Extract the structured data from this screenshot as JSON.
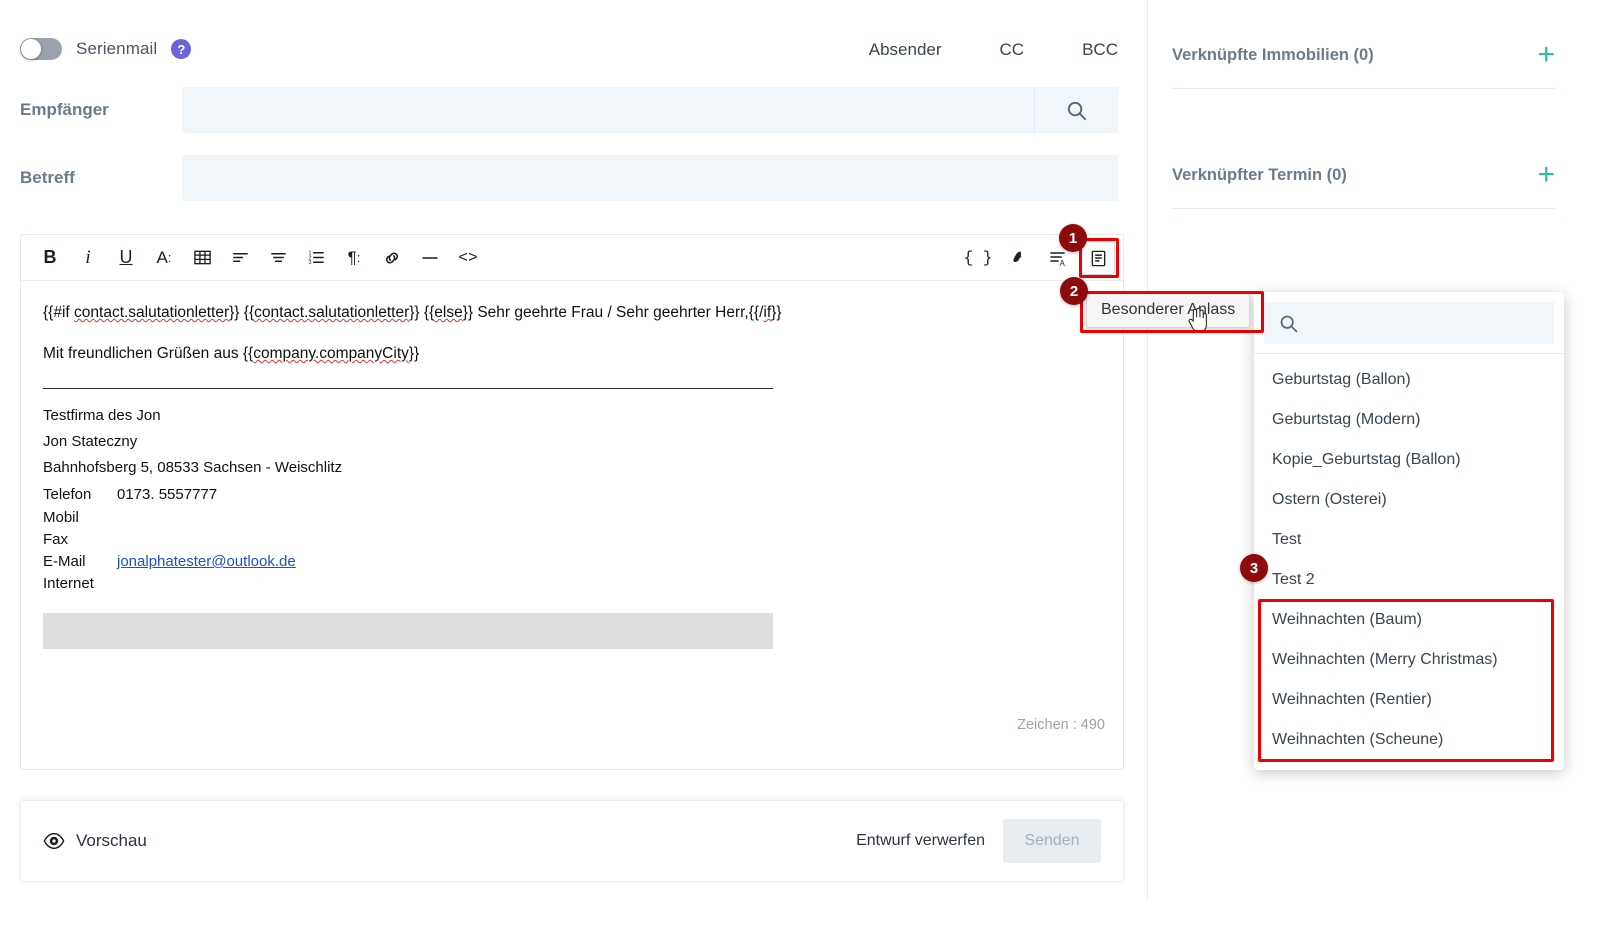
{
  "header": {
    "serienmail_label": "Serienmail",
    "serienmail_toggle_state": "off",
    "help_badge": "?",
    "address_tabs": [
      "Absender",
      "CC",
      "BCC"
    ]
  },
  "fields": {
    "recipient": {
      "label": "Empfänger",
      "value": "",
      "placeholder": ""
    },
    "subject": {
      "label": "Betreff",
      "value": "",
      "placeholder": ""
    }
  },
  "editor": {
    "toolbar_left": [
      {
        "name": "bold-icon",
        "glyph": "B"
      },
      {
        "name": "italic-icon",
        "glyph": "i"
      },
      {
        "name": "underline-icon",
        "glyph": "U"
      },
      {
        "name": "font-style-icon",
        "glyph": "A:"
      },
      {
        "name": "table-icon",
        "glyph": "table"
      },
      {
        "name": "align-left-icon",
        "glyph": "align-left"
      },
      {
        "name": "align-center-icon",
        "glyph": "align-center"
      },
      {
        "name": "ordered-list-icon",
        "glyph": "list"
      },
      {
        "name": "paragraph-icon",
        "glyph": "¶:"
      },
      {
        "name": "link-icon",
        "glyph": "link"
      },
      {
        "name": "horizontal-rule-icon",
        "glyph": "—"
      },
      {
        "name": "source-code-icon",
        "glyph": "<>"
      }
    ],
    "toolbar_right": [
      {
        "name": "placeholder-braces-icon",
        "glyph": "{ }"
      },
      {
        "name": "signature-stamp-icon",
        "glyph": "stamp"
      },
      {
        "name": "text-template-icon",
        "glyph": "text-a"
      },
      {
        "name": "special-occasion-template-icon",
        "glyph": "document"
      }
    ],
    "body": {
      "line1_parts": [
        {
          "text": "{{#if ",
          "spell": false
        },
        {
          "text": "contact.salutationletter",
          "spell": true
        },
        {
          "text": "}} {{",
          "spell": false
        },
        {
          "text": "contact.salutationletter",
          "spell": true
        },
        {
          "text": "}} {{",
          "spell": false
        },
        {
          "text": "else",
          "spell": true
        },
        {
          "text": "}} Sehr geehrte Frau / Sehr geehrter Herr,{{/",
          "spell": false
        },
        {
          "text": "if",
          "spell": true
        },
        {
          "text": "}}",
          "spell": false
        }
      ],
      "line2_parts": [
        {
          "text": "Mit freundlichen Grüßen aus {{",
          "spell": false
        },
        {
          "text": "company.companyCity",
          "spell": true
        },
        {
          "text": "}}",
          "spell": false
        }
      ],
      "signature": {
        "company": "Testfirma des Jon",
        "person": "Jon Stateczny",
        "address": "Bahnhofsberg 5, 08533 Sachsen - Weischlitz",
        "rows": [
          {
            "key": "Telefon",
            "value": "0173. 5557777",
            "link": false
          },
          {
            "key": "Mobil",
            "value": "",
            "link": false
          },
          {
            "key": "Fax",
            "value": "",
            "link": false
          },
          {
            "key": "E-Mail",
            "value": "jonalphatester@outlook.de",
            "link": true
          },
          {
            "key": "Internet",
            "value": "",
            "link": false
          }
        ]
      }
    },
    "char_count": "Zeichen : 490"
  },
  "footer": {
    "preview_label": "Vorschau",
    "discard_label": "Entwurf verwerfen",
    "send_label": "Senden"
  },
  "sidebar": {
    "sections": [
      {
        "title": "Verknüpfte Immobilien (0)",
        "add": "+"
      },
      {
        "title": "Verknüpfter Termin (0)",
        "add": "+"
      }
    ]
  },
  "tooltip": {
    "text": "Besonderer Anlass"
  },
  "dropdown": {
    "search_placeholder": "",
    "search_value": "",
    "items": [
      "Geburtstag (Ballon)",
      "Geburtstag (Modern)",
      "Kopie_Geburtstag (Ballon)",
      "Ostern (Osterei)",
      "Test",
      "Test 2",
      "Weihnachten (Baum)",
      "Weihnachten (Merry Christmas)",
      "Weihnachten (Rentier)",
      "Weihnachten (Scheune)"
    ]
  },
  "annotations": [
    {
      "number": "1"
    },
    {
      "number": "2"
    },
    {
      "number": "3"
    }
  ],
  "colors": {
    "accent_teal": "#2bbbab",
    "help_purple": "#6c63d9",
    "annotation_red": "#ee0000",
    "annotation_badge": "#8f0b0b",
    "field_bg": "#f1f6fa",
    "label_gray": "#6b7b8c"
  }
}
